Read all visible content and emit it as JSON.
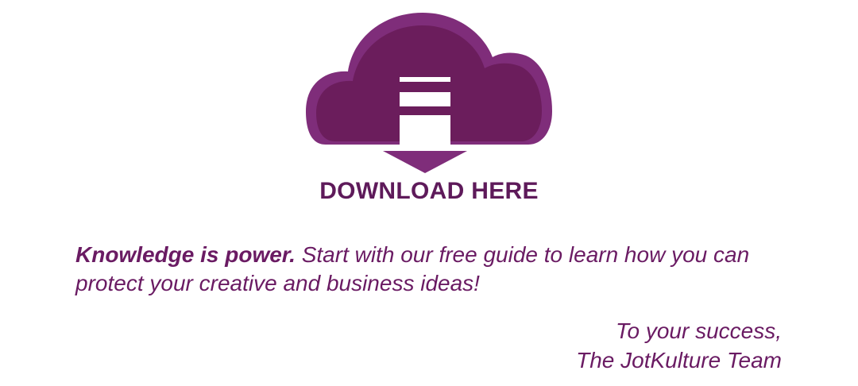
{
  "download": {
    "icon": "cloud-download-icon",
    "label": "DOWNLOAD HERE"
  },
  "intro": {
    "bold_text": "Knowledge is power.",
    "body_text": " Start with our free guide to learn how you can protect your creative and business ideas!"
  },
  "signoff": {
    "line1": "To your success,",
    "line2": "The JotKulture Team"
  },
  "colors": {
    "brand_dark": "#5e1a5a",
    "brand_mid": "#6b1d5c",
    "brand_light": "#7f2d7a",
    "text": "#6a1b63",
    "background": "#ffffff"
  }
}
